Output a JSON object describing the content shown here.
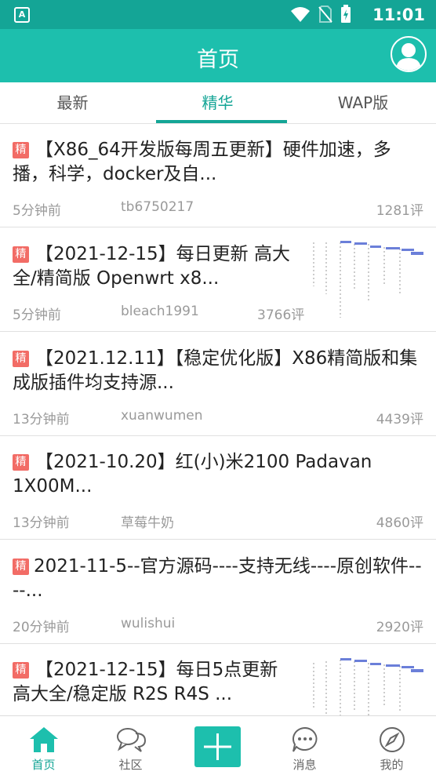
{
  "status_bar": {
    "time": "11:01",
    "app_badge": "A"
  },
  "header": {
    "title": "首页"
  },
  "tabs": [
    {
      "label": "最新"
    },
    {
      "label": "精华"
    },
    {
      "label": "WAP版"
    }
  ],
  "badge_text": "精",
  "items": [
    {
      "title": "【X86_64开发版每周五更新】硬件加速，多播，科学，docker及自...",
      "time": "5分钟前",
      "author": "tb6750217",
      "comments": "1281评"
    },
    {
      "title": "【2021-12-15】每日更新 高大全/精简版 Openwrt x8...",
      "time": "5分钟前",
      "author": "bleach1991",
      "comments": "3766评"
    },
    {
      "title": "【2021.12.11】【稳定优化版】X86精简版和集成版插件均支持源...",
      "time": "13分钟前",
      "author": "xuanwumen",
      "comments": "4439评"
    },
    {
      "title": "【2021-10.20】红(小)米2100 Padavan 1X00M...",
      "time": "13分钟前",
      "author": "草莓牛奶",
      "comments": "4860评"
    },
    {
      "title": "2021-11-5--官方源码----支持无线----原创软件----...",
      "time": "20分钟前",
      "author": "wulishui",
      "comments": "2920评"
    },
    {
      "title": "【2021-12-15】每日5点更新 高大全/稳定版 R2S R4S ...",
      "time": "",
      "author": "",
      "comments": ""
    }
  ],
  "bottom_nav": [
    {
      "label": "首页",
      "icon": "home-icon"
    },
    {
      "label": "社区",
      "icon": "chat-bubbles-icon"
    },
    {
      "label": "",
      "icon": "plus-icon"
    },
    {
      "label": "消息",
      "icon": "message-icon"
    },
    {
      "label": "我的",
      "icon": "compass-icon"
    }
  ],
  "colors": {
    "accent": "#1dbfad",
    "accent_dark": "#14a596",
    "badge": "#f26c66"
  }
}
